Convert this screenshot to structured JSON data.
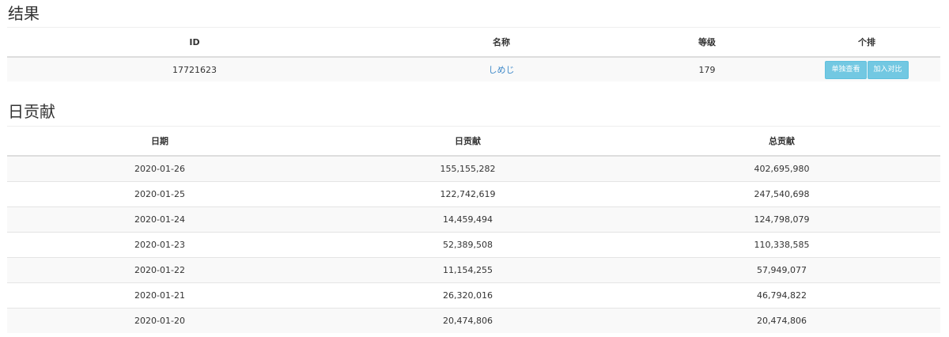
{
  "result": {
    "title": "结果",
    "columns": [
      "ID",
      "名称",
      "等级",
      "个排"
    ],
    "row": {
      "id": "17721623",
      "name": "しめじ",
      "level": "179",
      "buttons": [
        "单独查看",
        "加入对比"
      ]
    }
  },
  "daily": {
    "title": "日贡献",
    "columns": [
      "日期",
      "日贡献",
      "总贡献"
    ],
    "rows": [
      [
        "2020-01-26",
        "155,155,282",
        "402,695,980"
      ],
      [
        "2020-01-25",
        "122,742,619",
        "247,540,698"
      ],
      [
        "2020-01-24",
        "14,459,494",
        "124,798,079"
      ],
      [
        "2020-01-23",
        "52,389,508",
        "110,338,585"
      ],
      [
        "2020-01-22",
        "11,154,255",
        "57,949,077"
      ],
      [
        "2020-01-21",
        "26,320,016",
        "46,794,822"
      ],
      [
        "2020-01-20",
        "20,474,806",
        "20,474,806"
      ]
    ]
  },
  "colors": {
    "link": "#428bca",
    "button": "#5bc0de",
    "stripe": "#f9f9f9"
  }
}
